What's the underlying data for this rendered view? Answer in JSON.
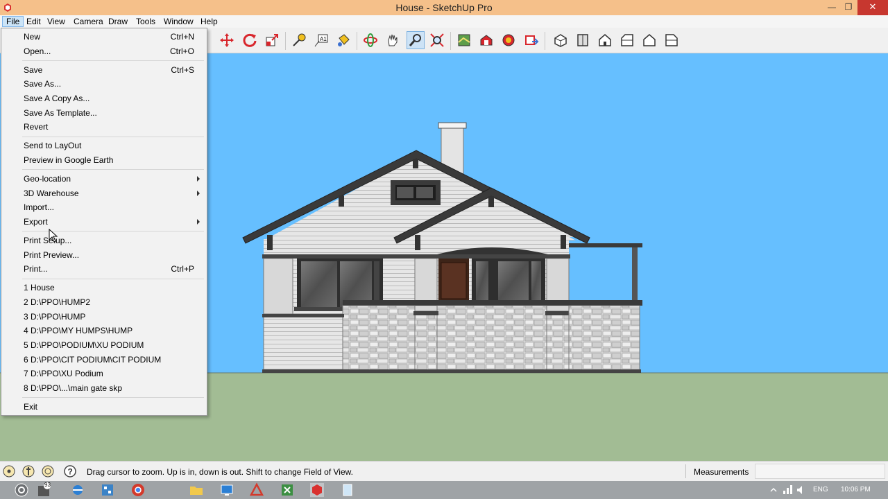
{
  "window": {
    "title": "House - SketchUp Pro"
  },
  "menubar": {
    "items": [
      "File",
      "Edit",
      "View",
      "Camera",
      "Draw",
      "Tools",
      "Window",
      "Help"
    ]
  },
  "file_menu": {
    "groups": [
      [
        {
          "label": "New",
          "shortcut": "Ctrl+N"
        },
        {
          "label": "Open...",
          "shortcut": "Ctrl+O"
        }
      ],
      [
        {
          "label": "Save",
          "shortcut": "Ctrl+S"
        },
        {
          "label": "Save As...",
          "shortcut": ""
        },
        {
          "label": "Save A Copy As...",
          "shortcut": ""
        },
        {
          "label": "Save As Template...",
          "shortcut": ""
        },
        {
          "label": "Revert",
          "shortcut": ""
        }
      ],
      [
        {
          "label": "Send to LayOut",
          "shortcut": ""
        },
        {
          "label": "Preview in Google Earth",
          "shortcut": ""
        }
      ],
      [
        {
          "label": "Geo-location",
          "shortcut": "",
          "submenu": true
        },
        {
          "label": "3D Warehouse",
          "shortcut": "",
          "submenu": true
        },
        {
          "label": "Import...",
          "shortcut": ""
        },
        {
          "label": "Export",
          "shortcut": "",
          "submenu": true
        }
      ],
      [
        {
          "label": "Print Setup...",
          "shortcut": ""
        },
        {
          "label": "Print Preview...",
          "shortcut": ""
        },
        {
          "label": "Print...",
          "shortcut": "Ctrl+P"
        }
      ],
      [
        {
          "label": "1 House",
          "shortcut": ""
        },
        {
          "label": "2 D:\\PPO\\HUMP2",
          "shortcut": ""
        },
        {
          "label": "3 D:\\PPO\\HUMP",
          "shortcut": ""
        },
        {
          "label": "4 D:\\PPO\\MY HUMPS\\HUMP",
          "shortcut": ""
        },
        {
          "label": "5 D:\\PPO\\PODIUM\\XU PODIUM",
          "shortcut": ""
        },
        {
          "label": "6 D:\\PPO\\CIT PODIUM\\CIT PODIUM",
          "shortcut": ""
        },
        {
          "label": "7 D:\\PPO\\XU Podium",
          "shortcut": ""
        },
        {
          "label": "8 D:\\PPO\\...\\main gate skp",
          "shortcut": ""
        }
      ],
      [
        {
          "label": "Exit",
          "shortcut": ""
        }
      ]
    ]
  },
  "toolbar": {
    "icons": [
      "move-icon",
      "rotate-icon",
      "scale-icon",
      "tape-measure-icon",
      "text-icon",
      "paint-bucket-icon",
      "orbit-icon",
      "pan-icon",
      "zoom-icon",
      "zoom-extents-icon",
      "add-location-icon",
      "get-models-icon",
      "share-model-icon",
      "share-component-icon",
      "iso-view-icon",
      "top-view-icon",
      "front-view-icon",
      "right-view-icon",
      "back-view-icon",
      "left-view-icon"
    ],
    "selected": "zoom-icon"
  },
  "statusbar": {
    "hint": "Drag cursor to zoom.  Up is in, down is out. Shift to change Field of View.",
    "measurements_label": "Measurements",
    "measurements_value": ""
  },
  "taskbar": {
    "badge": "93",
    "language": "ENG",
    "time": "10:06 PM"
  },
  "colors": {
    "sky": "#66bfff",
    "ground": "#a2bc94",
    "titlebar": "#f5c08a",
    "close": "#c7372f"
  }
}
